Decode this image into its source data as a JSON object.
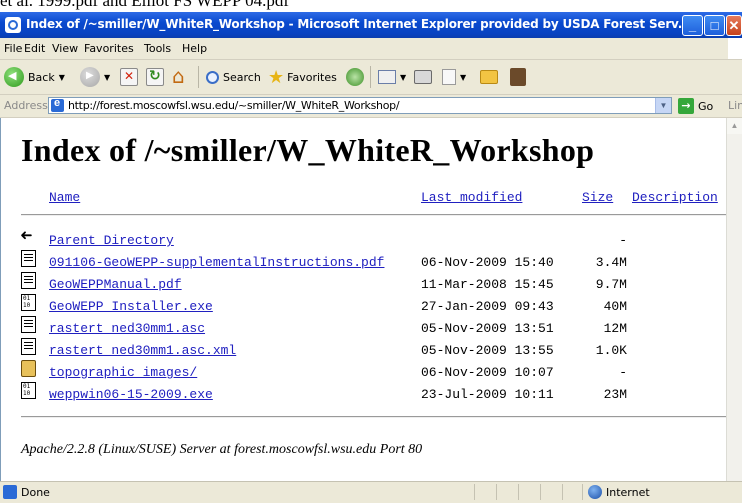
{
  "page_top_text": "et al. 1999.pdf and Elliot FS WEPP 04.pdf",
  "window": {
    "title": "Index of /~smiller/W_WhiteR_Workshop - Microsoft Internet Explorer provided by USDA Forest Serv...",
    "buttons": {
      "minimize": "_",
      "maximize": "□",
      "close": "✕"
    }
  },
  "menu": [
    "File",
    "Edit",
    "View",
    "Favorites",
    "Tools",
    "Help"
  ],
  "toolbar": {
    "back_label": "Back",
    "search_label": "Search",
    "favorites_label": "Favorites"
  },
  "address": {
    "label": "Address",
    "url": "http://forest.moscowfsl.wsu.edu/~smiller/W_WhiteR_Workshop/",
    "go_label": "Go",
    "links_label": "Links"
  },
  "page": {
    "heading": "Index of /~smiller/W_WhiteR_Workshop",
    "columns": {
      "name": "Name",
      "modified": "Last modified",
      "size": "Size",
      "description": "Description"
    },
    "entries": [
      {
        "name": "Parent Directory",
        "date": "",
        "size": "-",
        "icon": "back-icon"
      },
      {
        "name": "091106-GeoWEPP-supplementalInstructions.pdf",
        "date": "06-Nov-2009 15:40",
        "size": "3.4M",
        "icon": "text-file-icon"
      },
      {
        "name": "GeoWEPPManual.pdf",
        "date": "11-Mar-2008 15:45",
        "size": "9.7M",
        "icon": "text-file-icon"
      },
      {
        "name": "GeoWEPP_Installer.exe",
        "date": "27-Jan-2009 09:43",
        "size": "40M",
        "icon": "binary-file-icon"
      },
      {
        "name": "rastert_ned30mm1.asc",
        "date": "05-Nov-2009 13:51",
        "size": "12M",
        "icon": "text-file-icon"
      },
      {
        "name": "rastert_ned30mm1.asc.xml",
        "date": "05-Nov-2009 13:55",
        "size": "1.0K",
        "icon": "text-file-icon"
      },
      {
        "name": "topographic_images/",
        "date": "06-Nov-2009 10:07",
        "size": "-",
        "icon": "folder-icon"
      },
      {
        "name": "weppwin06-15-2009.exe",
        "date": "23-Jul-2009 10:11",
        "size": "23M",
        "icon": "binary-file-icon"
      }
    ],
    "server_signature": "Apache/2.2.8 (Linux/SUSE) Server at forest.moscowfsl.wsu.edu Port 80"
  },
  "status": {
    "text": "Done",
    "zone": "Internet"
  },
  "colors": {
    "titlebar": "#0A4ACF",
    "chrome": "#ECE9D8",
    "link": "#2020C0"
  }
}
